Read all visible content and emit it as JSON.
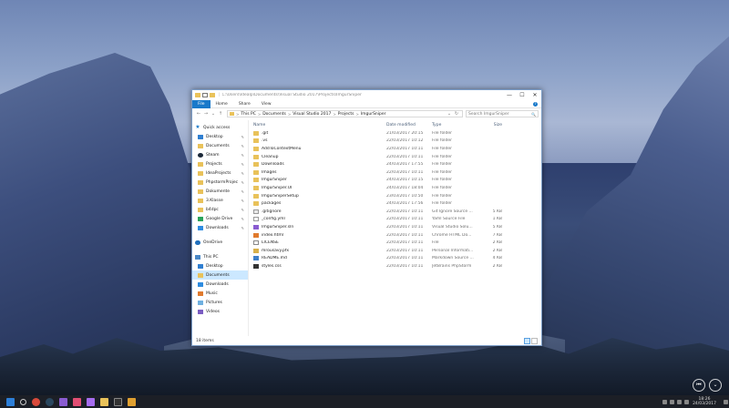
{
  "window": {
    "title_path": "C:\\Users\\Idealp\\Documents\\Visual Studio 2017\\Projects\\ImgurSniper",
    "controls": {
      "minimize": "—",
      "maximize": "☐",
      "close": "✕"
    }
  },
  "ribbon": {
    "tabs": [
      "File",
      "Home",
      "Share",
      "View"
    ],
    "help": "?"
  },
  "addressbar": {
    "back": "←",
    "forward": "→",
    "up": "↑",
    "crumbs": [
      "This PC",
      "Documents",
      "Visual Studio 2017",
      "Projects",
      "ImgurSniper"
    ],
    "separator": ">",
    "dropdown": "⌄",
    "refresh": "↻",
    "search_placeholder": "Search ImgurSniper",
    "search_icon": "🔍"
  },
  "navpane": {
    "quick_access": "Quick access",
    "quick_items": [
      {
        "label": "Desktop",
        "icon": "blue"
      },
      {
        "label": "Documents",
        "icon": "folder"
      },
      {
        "label": "Steam",
        "icon": "steam"
      },
      {
        "label": "Projects",
        "icon": "folder"
      },
      {
        "label": "IdeaProjects",
        "icon": "folder"
      },
      {
        "label": "PhpstormProjec",
        "icon": "folder"
      },
      {
        "label": "Dokumente",
        "icon": "folder"
      },
      {
        "label": "3.Klasse",
        "icon": "folder"
      },
      {
        "label": "b4dpc",
        "icon": "folder"
      },
      {
        "label": "Google Drive",
        "icon": "gdrive"
      },
      {
        "label": "Downloads",
        "icon": "dl"
      }
    ],
    "onedrive": "OneDrive",
    "this_pc": "This PC",
    "pc_items": [
      {
        "label": "Desktop",
        "icon": "blue"
      },
      {
        "label": "Documents",
        "icon": "folder"
      },
      {
        "label": "Downloads",
        "icon": "dl"
      },
      {
        "label": "Music",
        "icon": "music"
      },
      {
        "label": "Pictures",
        "icon": "pic"
      },
      {
        "label": "Videos",
        "icon": "vid"
      }
    ],
    "pin_glyph": "✎"
  },
  "columns": {
    "name": "Name",
    "date": "Date modified",
    "type": "Type",
    "size": "Size"
  },
  "files": [
    {
      "name": ".git",
      "date": "21/03/2017 20:15",
      "type": "File folder",
      "size": "",
      "icon": "folder"
    },
    {
      "name": ".vs",
      "date": "22/03/2017 10:12",
      "type": "File folder",
      "size": "",
      "icon": "folder"
    },
    {
      "name": "AddToContextMenu",
      "date": "22/03/2017 10:11",
      "type": "File folder",
      "size": "",
      "icon": "folder"
    },
    {
      "name": "Cleanup",
      "date": "22/03/2017 10:11",
      "type": "File folder",
      "size": "",
      "icon": "folder"
    },
    {
      "name": "Downloads",
      "date": "24/03/2017 17:55",
      "type": "File folder",
      "size": "",
      "icon": "folder"
    },
    {
      "name": "Images",
      "date": "22/03/2017 10:11",
      "type": "File folder",
      "size": "",
      "icon": "folder"
    },
    {
      "name": "ImgurSniper",
      "date": "24/03/2017 10:15",
      "type": "File folder",
      "size": "",
      "icon": "folder"
    },
    {
      "name": "ImgurSniper.UI",
      "date": "24/03/2017 18:04",
      "type": "File folder",
      "size": "",
      "icon": "folder"
    },
    {
      "name": "ImgurSniperSetup",
      "date": "23/03/2017 10:50",
      "type": "File folder",
      "size": "",
      "icon": "folder"
    },
    {
      "name": "packages",
      "date": "24/03/2017 17:56",
      "type": "File folder",
      "size": "",
      "icon": "folder"
    },
    {
      "name": ".gitignore",
      "date": "22/03/2017 10:11",
      "type": "Git Ignore Source ...",
      "size": "5 KB",
      "icon": "git"
    },
    {
      "name": "_config.yml",
      "date": "22/03/2017 10:11",
      "type": "Yaml Source File",
      "size": "1 KB",
      "icon": "yaml"
    },
    {
      "name": "ImgurSniper.sln",
      "date": "22/03/2017 10:11",
      "type": "Visual Studio Solu...",
      "size": "5 KB",
      "icon": "sln"
    },
    {
      "name": "index.html",
      "date": "22/03/2017 10:11",
      "type": "Chrome HTML Do...",
      "size": "7 KB",
      "icon": "html"
    },
    {
      "name": "LICENSE",
      "date": "22/03/2017 10:11",
      "type": "File",
      "size": "2 KB",
      "icon": "lic"
    },
    {
      "name": "mrousavy.pfx",
      "date": "22/03/2017 10:11",
      "type": "Personal Informati...",
      "size": "2 KB",
      "icon": "pfx"
    },
    {
      "name": "README.md",
      "date": "22/03/2017 10:11",
      "type": "Markdown Source ...",
      "size": "4 KB",
      "icon": "md"
    },
    {
      "name": "styles.css",
      "date": "22/03/2017 10:11",
      "type": "JetBrains PhpStorm",
      "size": "2 KB",
      "icon": "css"
    }
  ],
  "statusbar": {
    "items": "18 items"
  },
  "taskbar": {
    "apps": [
      "windows",
      "search",
      "chrome",
      "steam",
      "visual-studio",
      "intellij",
      "phpstorm",
      "explorer",
      "terminal",
      "misc"
    ],
    "time": "18:26",
    "date": "24/03/2017"
  },
  "media": {
    "prev": "⏮",
    "next": "⌄"
  }
}
